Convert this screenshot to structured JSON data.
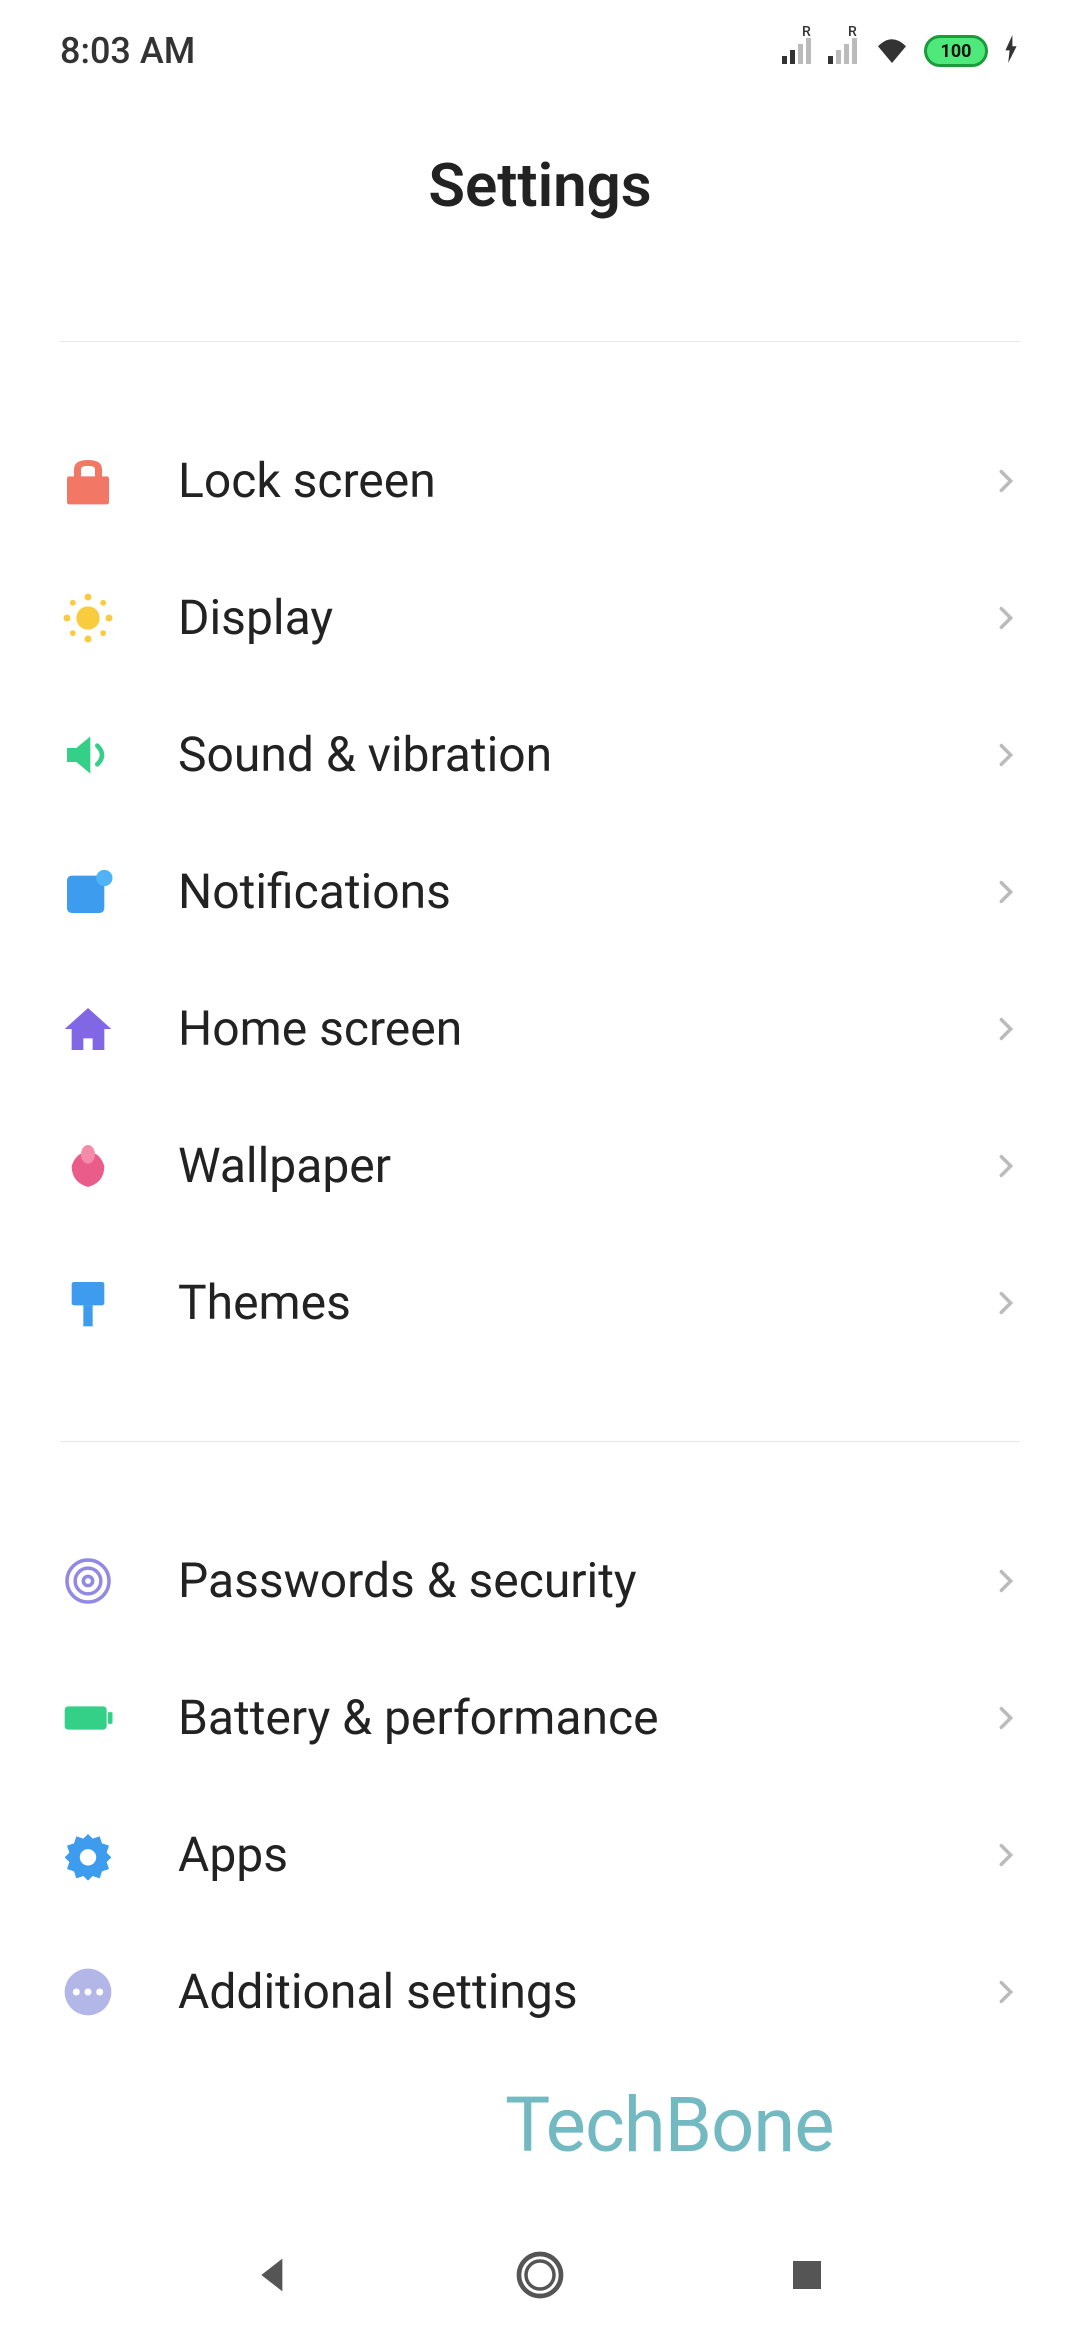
{
  "statusBar": {
    "time": "8:03 AM",
    "battery": "100"
  },
  "header": {
    "title": "Settings"
  },
  "sections": [
    {
      "items": [
        {
          "icon": "lock",
          "label": "Lock screen",
          "color": "#f27764"
        },
        {
          "icon": "sun",
          "label": "Display",
          "color": "#f9cb3e"
        },
        {
          "icon": "sound",
          "label": "Sound & vibration",
          "color": "#35d088"
        },
        {
          "icon": "bell",
          "label": "Notifications",
          "color": "#3e9cee"
        },
        {
          "icon": "home",
          "label": "Home screen",
          "color": "#8267e5"
        },
        {
          "icon": "flower",
          "label": "Wallpaper",
          "color": "#ea5d8a"
        },
        {
          "icon": "brush",
          "label": "Themes",
          "color": "#3e9cee"
        }
      ]
    },
    {
      "items": [
        {
          "icon": "fingerprint",
          "label": "Passwords & security",
          "color": "#9189e4"
        },
        {
          "icon": "battery",
          "label": "Battery & performance",
          "color": "#35d088"
        },
        {
          "icon": "gear",
          "label": "Apps",
          "color": "#3e9cee"
        },
        {
          "icon": "dots",
          "label": "Additional settings",
          "color": "#b3b7e8"
        }
      ]
    }
  ],
  "watermark": "TechBone"
}
